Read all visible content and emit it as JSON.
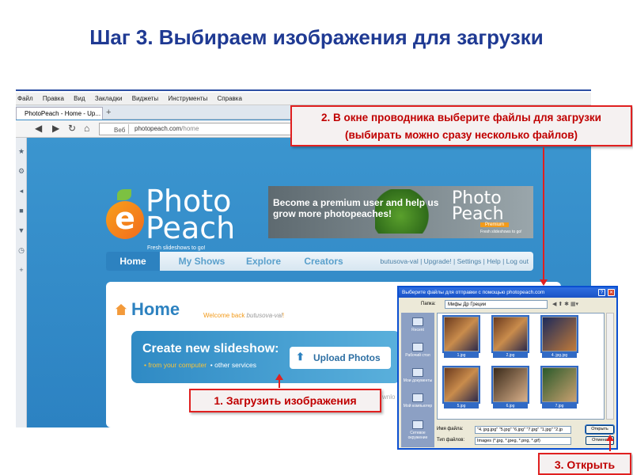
{
  "slide": {
    "title": "Шаг 3. Выбираем изображения для загрузки"
  },
  "browser": {
    "menu": [
      "Файл",
      "Правка",
      "Вид",
      "Закладки",
      "Виджеты",
      "Инструменты",
      "Справка"
    ],
    "tab_title": "PhotoPeach - Home - Up...",
    "address_prefix": "Веб",
    "url_host": "photopeach.com",
    "url_path": "/home"
  },
  "site": {
    "logo_line1": "Photo",
    "logo_line2": "Peach",
    "logo_tagline": "Fresh slideshows to go!",
    "banner_text": "Become a premium user and help us grow more photopeaches!",
    "banner_logo": "Photo Peach",
    "banner_premium": "Premium",
    "banner_tagline": "Fresh slideshows to go!",
    "nav": [
      "Home",
      "My Shows",
      "Explore",
      "Creators"
    ],
    "user": "butusova-val",
    "user_links": " | Upgrade! | Settings | Help | Log out",
    "upgrade": "Upgrade!",
    "home_title": "Home",
    "welcome_prefix": "Welcome back ",
    "welcome_user": "butusova-val",
    "welcome_suffix": "!",
    "create_title": "Create new slideshow:",
    "create_from": "• from your computer",
    "create_other": "• other services",
    "upload_button": "Upload Photos",
    "partial_text": "wnlo"
  },
  "dialog": {
    "title": "Выберите файлы для отправки с помощью photopeach.com",
    "folder_label": "Папка:",
    "folder_value": "Мифы Др Греции",
    "places": [
      "Recent",
      "Рабочий стол",
      "Мои документы",
      "Мой компьютер",
      "Сетевое окружение"
    ],
    "files": [
      "1.jpg",
      "2.jpg",
      "4. jpg.jpg",
      "5.jpg",
      "6.jpg",
      "7.jpg"
    ],
    "filename_label": "Имя файла:",
    "filename_value": "\"4. jpg.jpg\" \"5.jpg\" \"6.jpg\" \"7.jpg\" \"1.jpg\" \"2.jp",
    "filetype_label": "Тип файлов:",
    "filetype_value": "Images (*.jpg, *.jpeg, *.png, *.gif)",
    "open_button": "Открыть",
    "cancel_button": "Отмена"
  },
  "callouts": {
    "step2_line1": "2. В окне проводника выберите файлы для загрузки",
    "step2_line2": "(выбирать можно сразу несколько файлов)",
    "step1": "1. Загрузить изображения",
    "step3": "3. Открыть"
  },
  "colors": {
    "title": "#1f3a93",
    "callout_border": "#e02020",
    "callout_text": "#c00000",
    "site_bg": "#3a8bc6"
  }
}
